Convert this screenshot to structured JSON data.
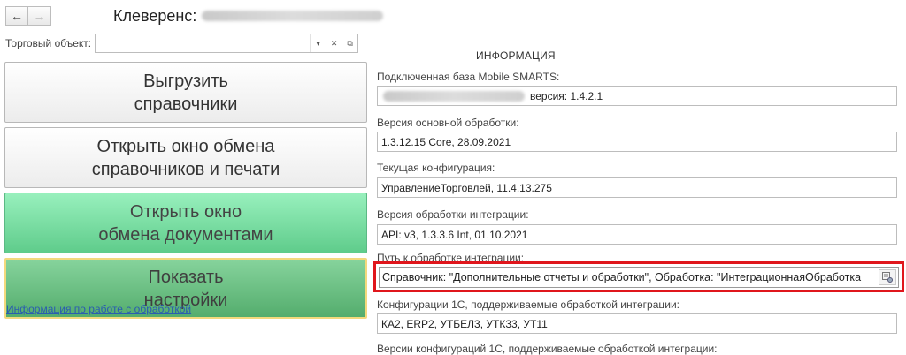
{
  "window": {
    "title": "Клеверенс:"
  },
  "nav": {
    "back": "←",
    "forward": "→"
  },
  "trade_object": {
    "label": "Торговый объект:",
    "value": "",
    "dropdown_icon": "chevron-down-icon",
    "clear_icon": "close-icon",
    "open_icon": "open-form-icon"
  },
  "buttons": {
    "export_directories": "Выгрузить\nсправочники",
    "open_exchange_print": "Открыть окно обмена\nсправочников и печати",
    "open_documents_exchange": "Открыть окно\nобмена документами",
    "show_settings": "Показать\nнастройки"
  },
  "info_link": "Информация по работе с обработкой",
  "info": {
    "heading": "ИНФОРМАЦИЯ",
    "fields": [
      {
        "label": "Подключенная база Mobile SMARTS:",
        "value": "версия: 1.4.2.1"
      },
      {
        "label": "Версия основной обработки:",
        "value": "1.3.12.15 Core, 28.09.2021"
      },
      {
        "label": "Текущая конфигурация:",
        "value": "УправлениеТорговлей, 11.4.13.275"
      },
      {
        "label": "Версия обработки интеграции:",
        "value": "API: v3, 1.3.3.6 Int, 01.10.2021"
      },
      {
        "label": "Путь к обработке интеграции:",
        "value": "Справочник: \"Дополнительные отчеты и обработки\", Обработка: \"ИнтеграционнаяОбработка"
      },
      {
        "label": "Конфигурации 1С, поддерживаемые обработкой интеграции:",
        "value": "КА2, ERP2, УТБЕЛ3, УТК33, УТ11"
      },
      {
        "label": "Версии конфигураций 1С, поддерживаемые обработкой интеграции:",
        "value": ""
      }
    ]
  },
  "colors": {
    "highlight": "#e0161c",
    "link": "#2a5db0",
    "green_button": "#6fd99b"
  }
}
